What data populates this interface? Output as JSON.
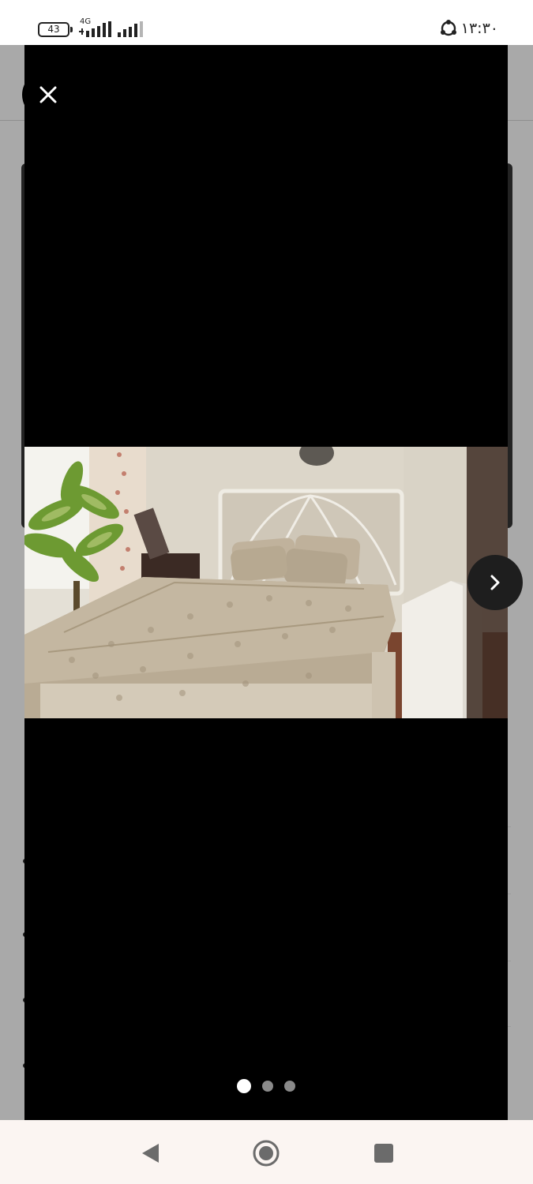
{
  "status_bar": {
    "battery_level": "43",
    "network_type": "4G",
    "time": "۱۳:۳۰",
    "icons": [
      "battery-icon",
      "signal-icon-sim1",
      "signal-icon-sim2",
      "sync-icon"
    ]
  },
  "viewer": {
    "close_icon": "close-icon",
    "next_icon": "chevron-right-icon",
    "photo_subject": "bed",
    "image_count": 3,
    "current_index": 1
  },
  "navigation_bar": {
    "icons": [
      "back-triangle-icon",
      "home-circle-icon",
      "recents-square-icon"
    ]
  },
  "colors": {
    "viewer_background": "#000000",
    "dimmed_page": "#a9a9a9",
    "nav_background": "#fbf5f2",
    "active_dot": "#ffffff",
    "inactive_dot": "#8a8a8a"
  }
}
